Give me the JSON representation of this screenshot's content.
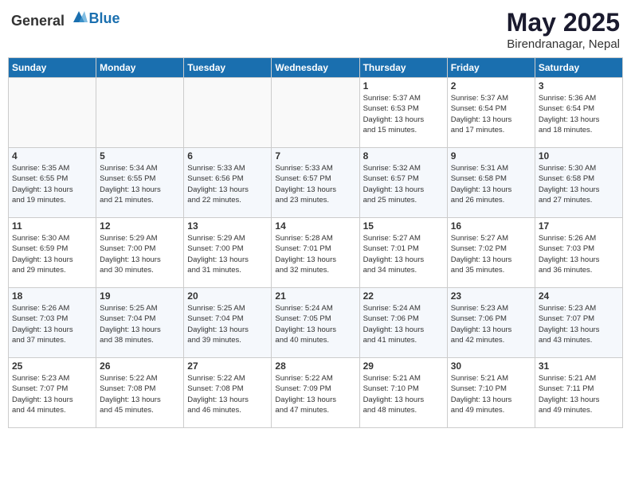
{
  "header": {
    "logo_general": "General",
    "logo_blue": "Blue",
    "month_title": "May 2025",
    "subtitle": "Birendranagar, Nepal"
  },
  "weekdays": [
    "Sunday",
    "Monday",
    "Tuesday",
    "Wednesday",
    "Thursday",
    "Friday",
    "Saturday"
  ],
  "weeks": [
    [
      {
        "day": "",
        "info": ""
      },
      {
        "day": "",
        "info": ""
      },
      {
        "day": "",
        "info": ""
      },
      {
        "day": "",
        "info": ""
      },
      {
        "day": "1",
        "info": "Sunrise: 5:37 AM\nSunset: 6:53 PM\nDaylight: 13 hours\nand 15 minutes."
      },
      {
        "day": "2",
        "info": "Sunrise: 5:37 AM\nSunset: 6:54 PM\nDaylight: 13 hours\nand 17 minutes."
      },
      {
        "day": "3",
        "info": "Sunrise: 5:36 AM\nSunset: 6:54 PM\nDaylight: 13 hours\nand 18 minutes."
      }
    ],
    [
      {
        "day": "4",
        "info": "Sunrise: 5:35 AM\nSunset: 6:55 PM\nDaylight: 13 hours\nand 19 minutes."
      },
      {
        "day": "5",
        "info": "Sunrise: 5:34 AM\nSunset: 6:55 PM\nDaylight: 13 hours\nand 21 minutes."
      },
      {
        "day": "6",
        "info": "Sunrise: 5:33 AM\nSunset: 6:56 PM\nDaylight: 13 hours\nand 22 minutes."
      },
      {
        "day": "7",
        "info": "Sunrise: 5:33 AM\nSunset: 6:57 PM\nDaylight: 13 hours\nand 23 minutes."
      },
      {
        "day": "8",
        "info": "Sunrise: 5:32 AM\nSunset: 6:57 PM\nDaylight: 13 hours\nand 25 minutes."
      },
      {
        "day": "9",
        "info": "Sunrise: 5:31 AM\nSunset: 6:58 PM\nDaylight: 13 hours\nand 26 minutes."
      },
      {
        "day": "10",
        "info": "Sunrise: 5:30 AM\nSunset: 6:58 PM\nDaylight: 13 hours\nand 27 minutes."
      }
    ],
    [
      {
        "day": "11",
        "info": "Sunrise: 5:30 AM\nSunset: 6:59 PM\nDaylight: 13 hours\nand 29 minutes."
      },
      {
        "day": "12",
        "info": "Sunrise: 5:29 AM\nSunset: 7:00 PM\nDaylight: 13 hours\nand 30 minutes."
      },
      {
        "day": "13",
        "info": "Sunrise: 5:29 AM\nSunset: 7:00 PM\nDaylight: 13 hours\nand 31 minutes."
      },
      {
        "day": "14",
        "info": "Sunrise: 5:28 AM\nSunset: 7:01 PM\nDaylight: 13 hours\nand 32 minutes."
      },
      {
        "day": "15",
        "info": "Sunrise: 5:27 AM\nSunset: 7:01 PM\nDaylight: 13 hours\nand 34 minutes."
      },
      {
        "day": "16",
        "info": "Sunrise: 5:27 AM\nSunset: 7:02 PM\nDaylight: 13 hours\nand 35 minutes."
      },
      {
        "day": "17",
        "info": "Sunrise: 5:26 AM\nSunset: 7:03 PM\nDaylight: 13 hours\nand 36 minutes."
      }
    ],
    [
      {
        "day": "18",
        "info": "Sunrise: 5:26 AM\nSunset: 7:03 PM\nDaylight: 13 hours\nand 37 minutes."
      },
      {
        "day": "19",
        "info": "Sunrise: 5:25 AM\nSunset: 7:04 PM\nDaylight: 13 hours\nand 38 minutes."
      },
      {
        "day": "20",
        "info": "Sunrise: 5:25 AM\nSunset: 7:04 PM\nDaylight: 13 hours\nand 39 minutes."
      },
      {
        "day": "21",
        "info": "Sunrise: 5:24 AM\nSunset: 7:05 PM\nDaylight: 13 hours\nand 40 minutes."
      },
      {
        "day": "22",
        "info": "Sunrise: 5:24 AM\nSunset: 7:06 PM\nDaylight: 13 hours\nand 41 minutes."
      },
      {
        "day": "23",
        "info": "Sunrise: 5:23 AM\nSunset: 7:06 PM\nDaylight: 13 hours\nand 42 minutes."
      },
      {
        "day": "24",
        "info": "Sunrise: 5:23 AM\nSunset: 7:07 PM\nDaylight: 13 hours\nand 43 minutes."
      }
    ],
    [
      {
        "day": "25",
        "info": "Sunrise: 5:23 AM\nSunset: 7:07 PM\nDaylight: 13 hours\nand 44 minutes."
      },
      {
        "day": "26",
        "info": "Sunrise: 5:22 AM\nSunset: 7:08 PM\nDaylight: 13 hours\nand 45 minutes."
      },
      {
        "day": "27",
        "info": "Sunrise: 5:22 AM\nSunset: 7:08 PM\nDaylight: 13 hours\nand 46 minutes."
      },
      {
        "day": "28",
        "info": "Sunrise: 5:22 AM\nSunset: 7:09 PM\nDaylight: 13 hours\nand 47 minutes."
      },
      {
        "day": "29",
        "info": "Sunrise: 5:21 AM\nSunset: 7:10 PM\nDaylight: 13 hours\nand 48 minutes."
      },
      {
        "day": "30",
        "info": "Sunrise: 5:21 AM\nSunset: 7:10 PM\nDaylight: 13 hours\nand 49 minutes."
      },
      {
        "day": "31",
        "info": "Sunrise: 5:21 AM\nSunset: 7:11 PM\nDaylight: 13 hours\nand 49 minutes."
      }
    ]
  ]
}
